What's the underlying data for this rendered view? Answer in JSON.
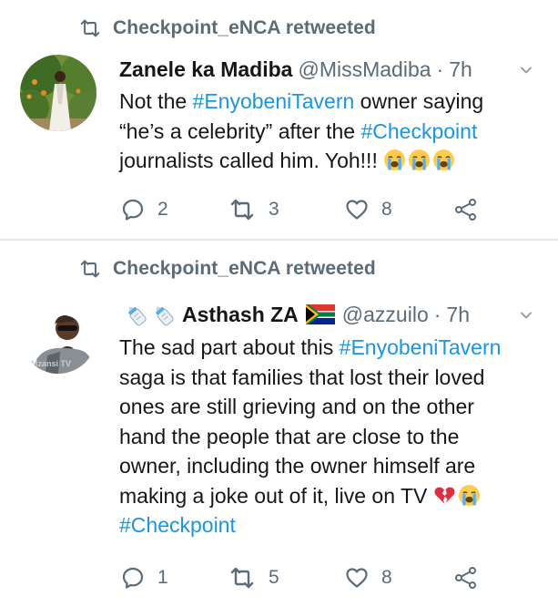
{
  "tweets": [
    {
      "retweeted_by": "Checkpoint_eNCA retweeted",
      "author": {
        "name": "Zanele ka Madiba",
        "handle": "@MissMadiba",
        "time": "7h"
      },
      "text": {
        "l1_a": "Not the ",
        "l1_tag": "#EnyobeniTavern",
        "l1_b": " owner saying",
        "l2_a": "“he’s a celebrity” after the ",
        "l2_tag": "#Checkpoint",
        "l3_a": "journalists called him. Yoh!!! "
      },
      "emojis": [
        "loudly-crying-face",
        "loudly-crying-face",
        "loudly-crying-face"
      ],
      "actions": {
        "replies": "2",
        "retweets": "3",
        "likes": "8"
      }
    },
    {
      "retweeted_by": "Checkpoint_eNCA retweeted",
      "author": {
        "name": "Asthash ZA",
        "handle": "@azzuilo",
        "time": "7h"
      },
      "name_prefix_emojis": [
        "baby-bottle",
        "baby-bottle"
      ],
      "name_suffix_emoji": "south-africa-flag",
      "text": {
        "l1_a": "The sad part about this ",
        "l1_tag": "#EnyobeniTavern",
        "l2": "saga is that families that lost their loved",
        "l3": "ones are still grieving and on the other",
        "l4": "hand the people that are close to the",
        "l5": "owner, including the owner himself are",
        "l6": "making a joke out of it, live on TV ",
        "l7_tag": "#Checkpoint"
      },
      "emojis": [
        "broken-heart",
        "loudly-crying-face"
      ],
      "avatar_text": "Mzansi TV",
      "actions": {
        "replies": "1",
        "retweets": "5",
        "likes": "8"
      }
    }
  ],
  "colors": {
    "text": "#14171a",
    "secondary": "#5b6b78",
    "hashtag": "#1b95e0",
    "divider": "#e3e8ec"
  }
}
